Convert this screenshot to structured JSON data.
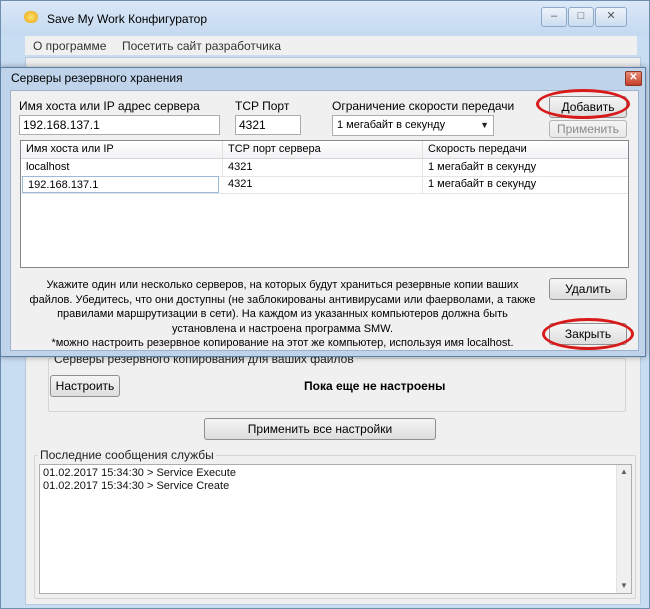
{
  "main_window": {
    "title": "Save My Work Конфигуратор",
    "menu": [
      "О программе",
      "Посетить сайт разработчика"
    ],
    "backup_group_label": "Серверы резервного копирования для ваших файлов",
    "configure_button": "Настроить",
    "servers_status": "Пока еще не настроены",
    "apply_all_button": "Применить все настройки",
    "log_label": "Последние сообщения службы",
    "log_lines": [
      "01.02.2017 15:34:30 > Service Execute",
      "01.02.2017 15:34:30 > Service Create"
    ]
  },
  "dialog": {
    "title": "Серверы резервного хранения",
    "host_label": "Имя хоста или IP адрес сервера",
    "host_value": "192.168.137.1",
    "port_label": "TCP Порт",
    "port_value": "4321",
    "speed_label": "Ограничение скорости передачи",
    "speed_value": "1 мегабайт в секунду",
    "add_button": "Добавить",
    "apply_button": "Применить",
    "delete_button": "Удалить",
    "close_button": "Закрыть",
    "table": {
      "columns": [
        "Имя хоста или IP",
        "TCP порт сервера",
        "Скорость передачи"
      ],
      "rows": [
        [
          "localhost",
          "4321",
          "1 мегабайт в секунду"
        ],
        [
          "192.168.137.1",
          "4321",
          "1 мегабайт в секунду"
        ]
      ]
    },
    "info_lines": [
      "Укажите один или несколько серверов, на которых будут храниться резервные копии ваших",
      "файлов. Убедитесь, что они доступны (не заблокированы антивирусами или фаерволами, а также",
      "правилами маршрутизации в сети). На каждом из указанных компьютеров должна быть",
      "установлена и настроена программа SMW.",
      "*можно настроить резервное копирование на этот же компьютер, используя имя localhost."
    ]
  },
  "colors": {
    "annotation": "#d81a1a",
    "title_bar": "#c4d9f0"
  },
  "icons": {
    "app": "app-icon",
    "minimize": "minimize-icon",
    "maximize": "maximize-icon",
    "close": "close-icon",
    "dropdown": "chevron-down-icon"
  }
}
